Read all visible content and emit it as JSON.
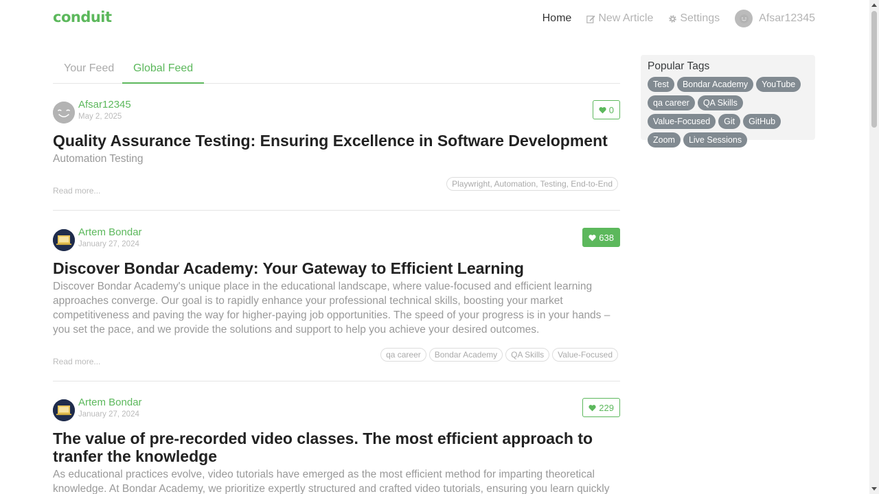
{
  "brand": "conduit",
  "nav": {
    "home": "Home",
    "new_article": "New Article",
    "settings": "Settings",
    "user": "Afsar12345"
  },
  "feed_tabs": {
    "your": "Your Feed",
    "global": "Global Feed"
  },
  "articles": [
    {
      "author": "Afsar12345",
      "date": "May 2, 2025",
      "likes": "0",
      "title": "Quality Assurance Testing: Ensuring Excellence in Software Development",
      "description": "Automation Testing",
      "read_more": "Read more...",
      "tags": [
        "Playwright, Automation, Testing, End-to-End"
      ]
    },
    {
      "author": "Artem Bondar",
      "date": "January 27, 2024",
      "likes": "638",
      "title": "Discover Bondar Academy: Your Gateway to Efficient Learning",
      "description": "Discover Bondar Academy's unique place in the educational landscape, where value-focused and efficient learning approaches converge. Our goal is to rapidly enhance your professional technical skills, boosting your market competitiveness and paving the way for higher-paying job opportunities. The speed of your progress is in your hands – you set the pace, and we provide the solutions and support to help you achieve your desired outcomes.",
      "read_more": "Read more...",
      "tags": [
        "qa career",
        "Bondar Academy",
        "QA Skills",
        "Value-Focused"
      ]
    },
    {
      "author": "Artem Bondar",
      "date": "January 27, 2024",
      "likes": "229",
      "title": "The value of pre-recorded video classes. The most efficient approach to tranfer the knowledge",
      "description": "As educational practices evolve, video tutorials have emerged as the most efficient method for imparting theoretical knowledge. At Bondar Academy, we prioritize expertly structured and crafted video tutorials, ensuring you learn quickly and effectively and"
    }
  ],
  "sidebar": {
    "title": "Popular Tags",
    "tags": [
      "Test",
      "Bondar Academy",
      "YouTube",
      "qa career",
      "QA Skills",
      "Value-Focused",
      "Git",
      "GitHub",
      "Zoom",
      "Live Sessions"
    ]
  },
  "colors": {
    "accent": "#5cb85c",
    "tag_pill": "#818a91"
  }
}
